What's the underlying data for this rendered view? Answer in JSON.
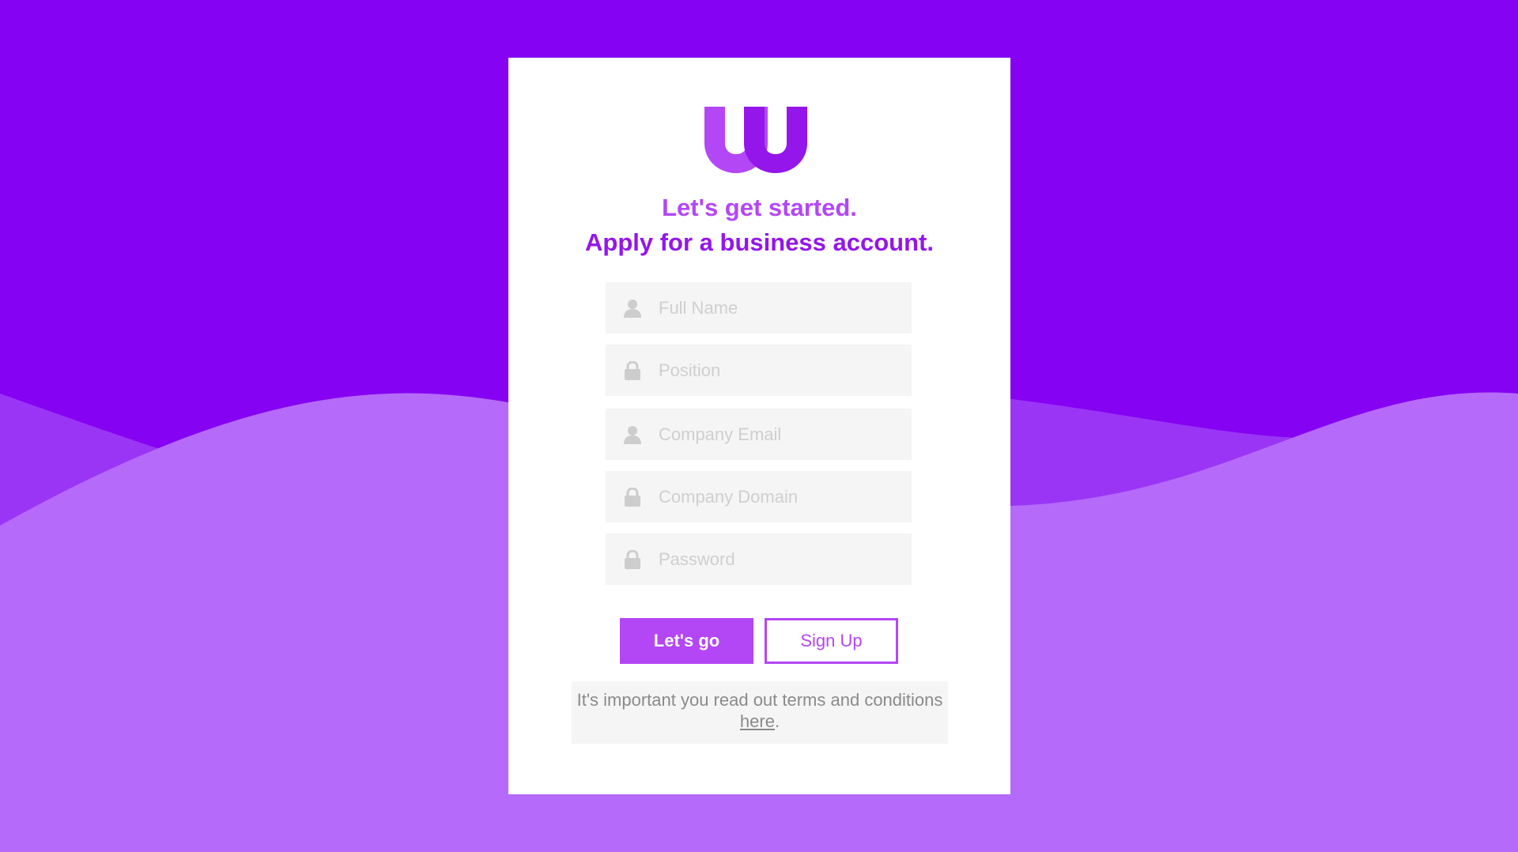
{
  "brand": {
    "logo_icon": "w-logo-icon",
    "primary_color": "#8502f2",
    "accent_color": "#b347f5",
    "logo_left_color": "#b347f5",
    "logo_right_color": "#9416ea"
  },
  "header": {
    "line1": "Let's get started.",
    "line2": "Apply for a business account."
  },
  "form": {
    "fields": [
      {
        "placeholder": "Full Name",
        "value": "",
        "icon": "user-icon"
      },
      {
        "placeholder": "Position",
        "value": "",
        "icon": "lock-icon"
      },
      {
        "placeholder": "Company Email",
        "value": "",
        "icon": "user-icon"
      },
      {
        "placeholder": "Company Domain",
        "value": "",
        "icon": "lock-icon"
      },
      {
        "placeholder": "Password",
        "value": "",
        "icon": "lock-icon"
      }
    ],
    "primary_label": "Let's go",
    "secondary_label": "Sign Up"
  },
  "terms": {
    "text_before": "It's important you read out terms and conditions ",
    "link_label": "here",
    "text_after": "."
  }
}
